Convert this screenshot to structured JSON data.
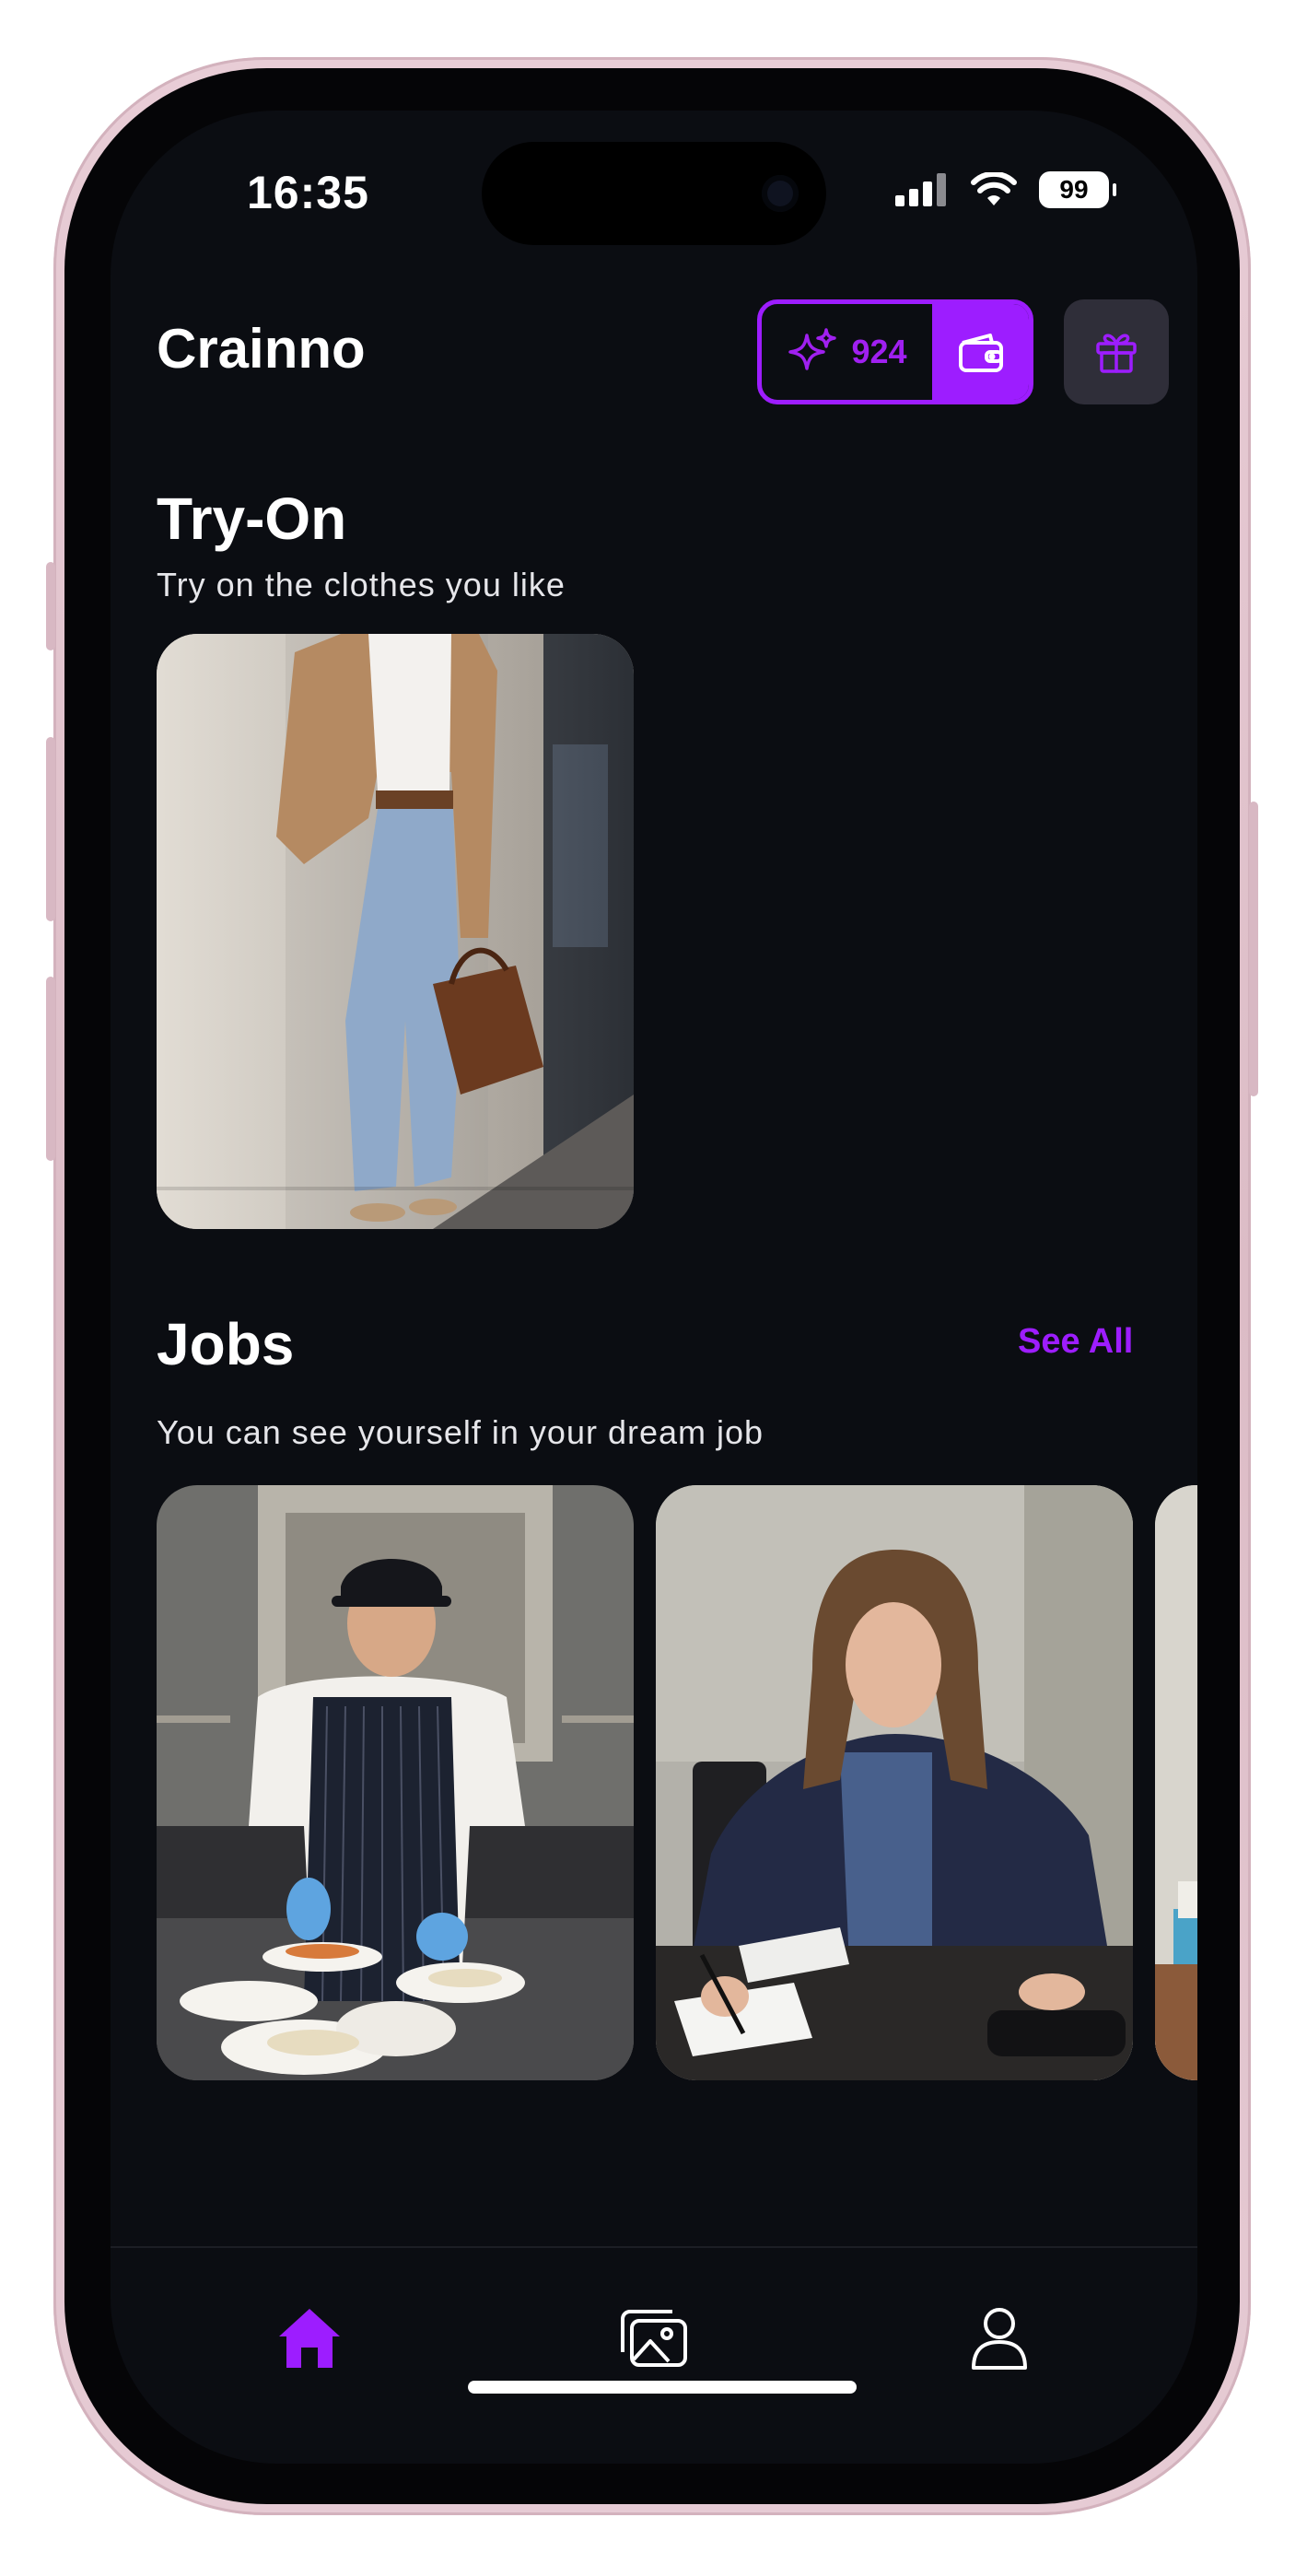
{
  "status_bar": {
    "time": "16:35",
    "battery": "99"
  },
  "header": {
    "brand": "Crainno",
    "credits": "924"
  },
  "try_on": {
    "title": "Try-On",
    "subtitle": "Try on the clothes you like",
    "image_alt": "Woman in tan blazer, white top and light jeans leaning on a stone wall holding a brown bag"
  },
  "jobs": {
    "title": "Jobs",
    "see_all": "See All",
    "subtitle": "You can see yourself in your dream job",
    "cards": [
      {
        "alt": "Chef in cap and striped apron plating food in a kitchen"
      },
      {
        "alt": "Woman in navy blazer writing notes at a desk"
      },
      {
        "alt": "Office desk with papers"
      }
    ]
  },
  "nav": {
    "items": [
      {
        "name": "home",
        "icon": "home-icon",
        "active": true
      },
      {
        "name": "gallery",
        "icon": "gallery-icon",
        "active": false
      },
      {
        "name": "profile",
        "icon": "profile-icon",
        "active": false
      }
    ]
  },
  "colors": {
    "accent": "#9d1dff",
    "background": "#0b0d12",
    "gift_bg": "#2f2e39"
  }
}
